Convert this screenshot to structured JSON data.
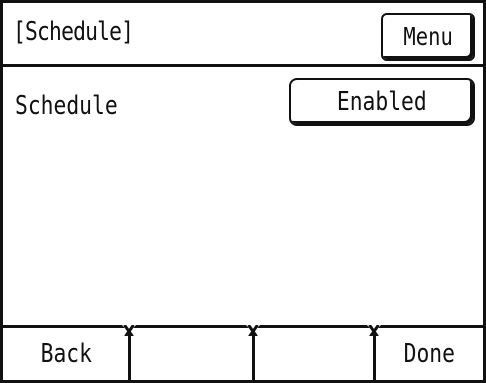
{
  "header": {
    "title": "[Schedule]",
    "menu_label": "Menu"
  },
  "main": {
    "schedule_label": "Schedule",
    "schedule_value": "Enabled"
  },
  "softkeys": {
    "key1": "Back",
    "key2": "",
    "key3": "",
    "key4": "Done"
  },
  "colors": {
    "foreground": "#111111",
    "background": "#ffffff"
  }
}
